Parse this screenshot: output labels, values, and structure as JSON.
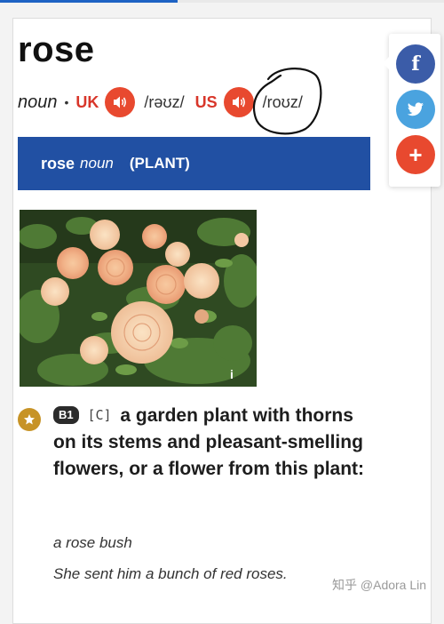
{
  "entry": {
    "headword": "rose",
    "part_of_speech": "noun",
    "separator": "•",
    "uk": {
      "label": "UK",
      "ipa": "/rəʊz/"
    },
    "us": {
      "label": "US",
      "ipa": "/roʊz/"
    }
  },
  "sense": {
    "word": "rose",
    "pos": "noun",
    "guideword": "(PLANT)"
  },
  "image": {
    "info_glyph": "i"
  },
  "definition": {
    "level": "B1",
    "grammar": "[C]",
    "text": "a garden plant with thorns on its stems and pleasant-smelling flowers, or a flower from this plant:",
    "examples": [
      "a rose bush",
      "She sent him a bunch of red roses."
    ]
  },
  "share": {
    "facebook_glyph": "f",
    "more_glyph": "+",
    "icons": [
      "facebook-icon",
      "twitter-icon",
      "plus-icon"
    ]
  },
  "watermark": "知乎 @Adora Lin",
  "colors": {
    "accent_red": "#e8492f",
    "sense_bar": "#2150a3",
    "facebook": "#3b5ca8",
    "twitter": "#4aa3df",
    "level_star": "#c79326"
  }
}
